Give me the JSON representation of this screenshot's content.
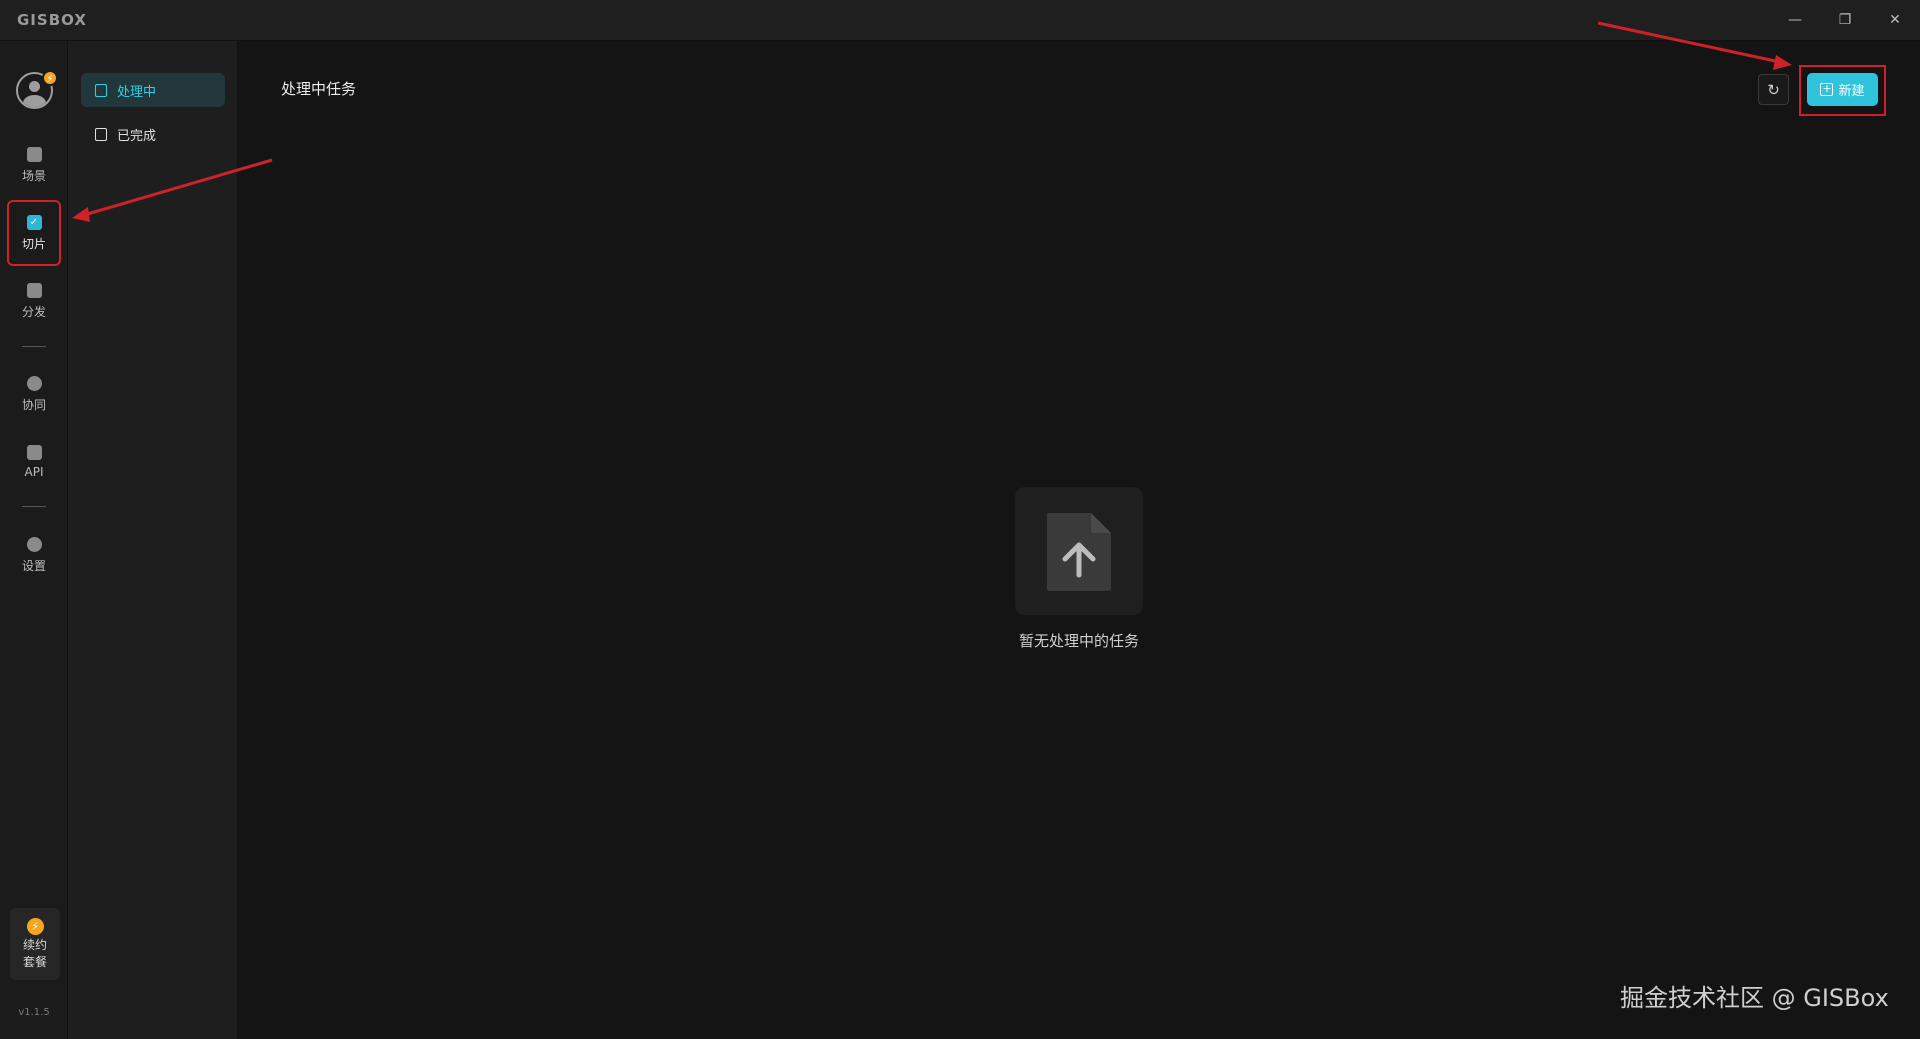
{
  "app": {
    "logo": "GISBOX"
  },
  "window_controls": {
    "minimize": "—",
    "maximize": "❐",
    "close": "✕"
  },
  "rail": {
    "avatar_badge": "⚡",
    "items": [
      {
        "label": "场景",
        "icon": "scene-icon",
        "active": false
      },
      {
        "label": "切片",
        "icon": "slice-icon",
        "active": true
      },
      {
        "label": "分发",
        "icon": "distribute-icon",
        "active": false
      },
      {
        "label": "协同",
        "icon": "collaborate-icon",
        "active": false
      },
      {
        "label": "API",
        "icon": "api-icon",
        "active": false
      },
      {
        "label": "设置",
        "icon": "settings-icon",
        "active": false
      }
    ],
    "renew": {
      "line1": "续约",
      "line2": "套餐",
      "icon": "⚡"
    },
    "version": "v1.1.5"
  },
  "subnav": {
    "items": [
      {
        "label": "处理中",
        "active": true
      },
      {
        "label": "已完成",
        "active": false
      }
    ]
  },
  "main": {
    "title": "处理中任务",
    "refresh_icon": "↻",
    "new_button": "新建",
    "empty_text": "暂无处理中的任务"
  },
  "colors": {
    "accent": "#2fc4dc",
    "annotation_red": "#d0202a",
    "badge_orange": "#f5a524"
  },
  "watermark": "掘金技术社区 @ GISBox"
}
